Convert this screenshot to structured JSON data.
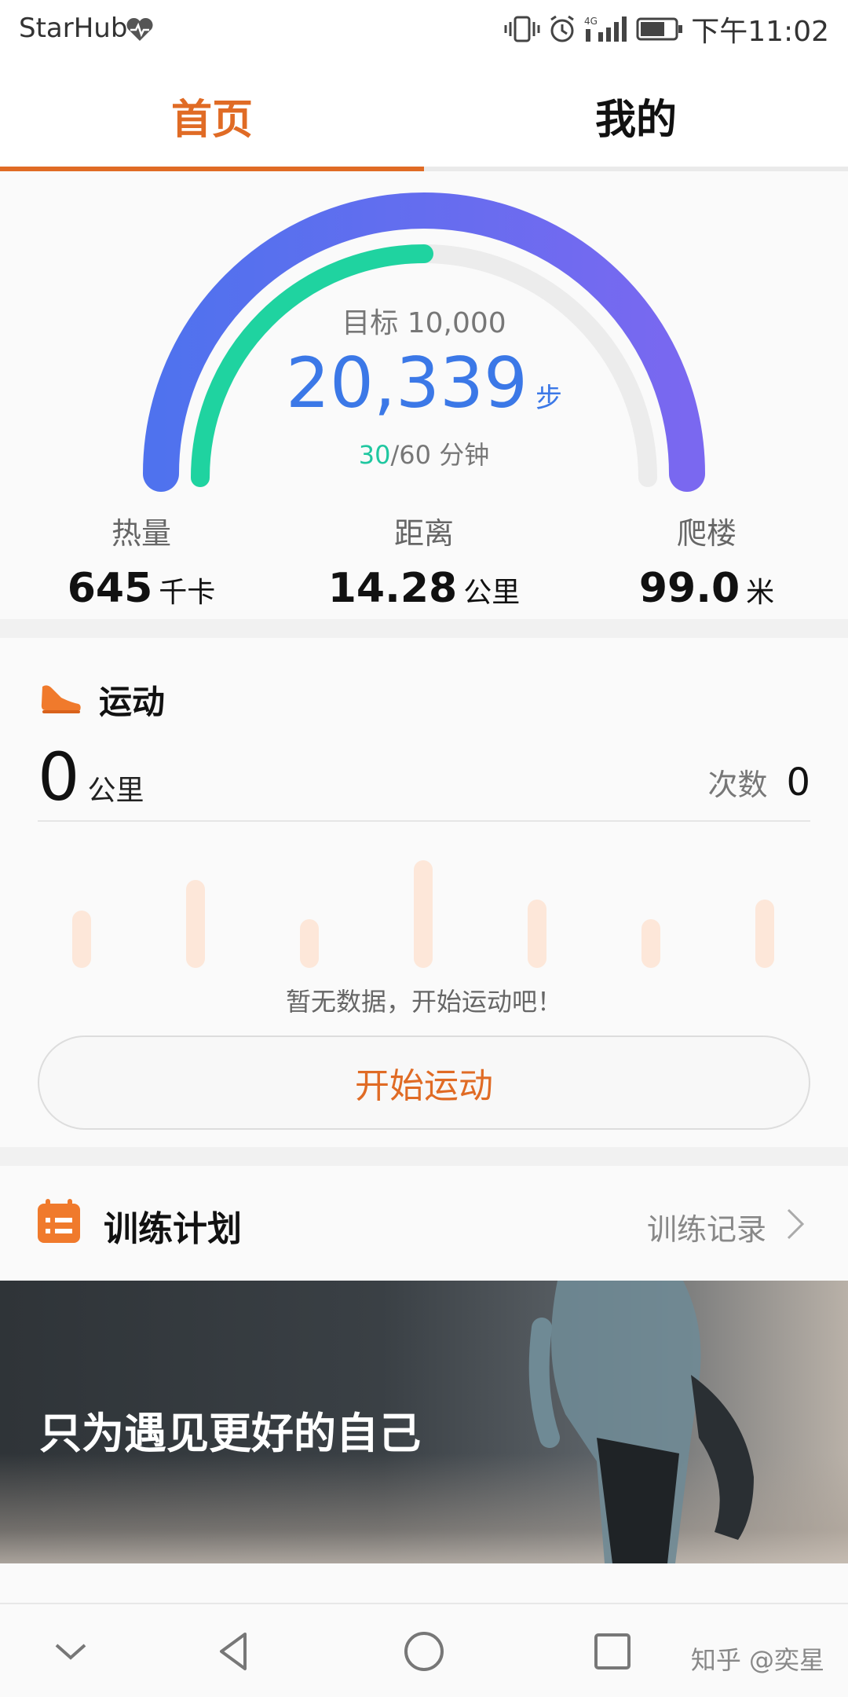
{
  "status_bar": {
    "carrier": "StarHub",
    "time": "下午11:02",
    "network": "4G"
  },
  "tabs": [
    {
      "label": "首页",
      "active": true
    },
    {
      "label": "我的",
      "active": false
    }
  ],
  "steps_card": {
    "goal_label": "目标 10,000",
    "steps": "20,339",
    "steps_unit": "步",
    "minutes_done": "30",
    "minutes_total": "/60 分钟",
    "stats": [
      {
        "label": "热量",
        "value": "645",
        "unit": "千卡"
      },
      {
        "label": "距离",
        "value": "14.28",
        "unit": "公里"
      },
      {
        "label": "爬楼",
        "value": "99.0",
        "unit": "米"
      }
    ],
    "minutes_progress": 0.5,
    "colors": {
      "outer": "#5b6ff0",
      "inner": "#1fd3a0",
      "track": "#ececec"
    }
  },
  "sport_card": {
    "title": "运动",
    "distance": "0",
    "distance_unit": "公里",
    "count_label": "次数",
    "count_value": "0",
    "empty_message": "暂无数据，开始运动吧！",
    "start_button": "开始运动",
    "placeholder_bars": [
      0.52,
      0.8,
      0.44,
      0.98,
      0.62,
      0.44,
      0.62
    ]
  },
  "plan_card": {
    "title": "训练计划",
    "record_link": "训练记录"
  },
  "banner": {
    "title": "只为遇见更好的自己"
  },
  "nav": {
    "watermark": "知乎 @奕星"
  },
  "accent_color": "#e06b25"
}
